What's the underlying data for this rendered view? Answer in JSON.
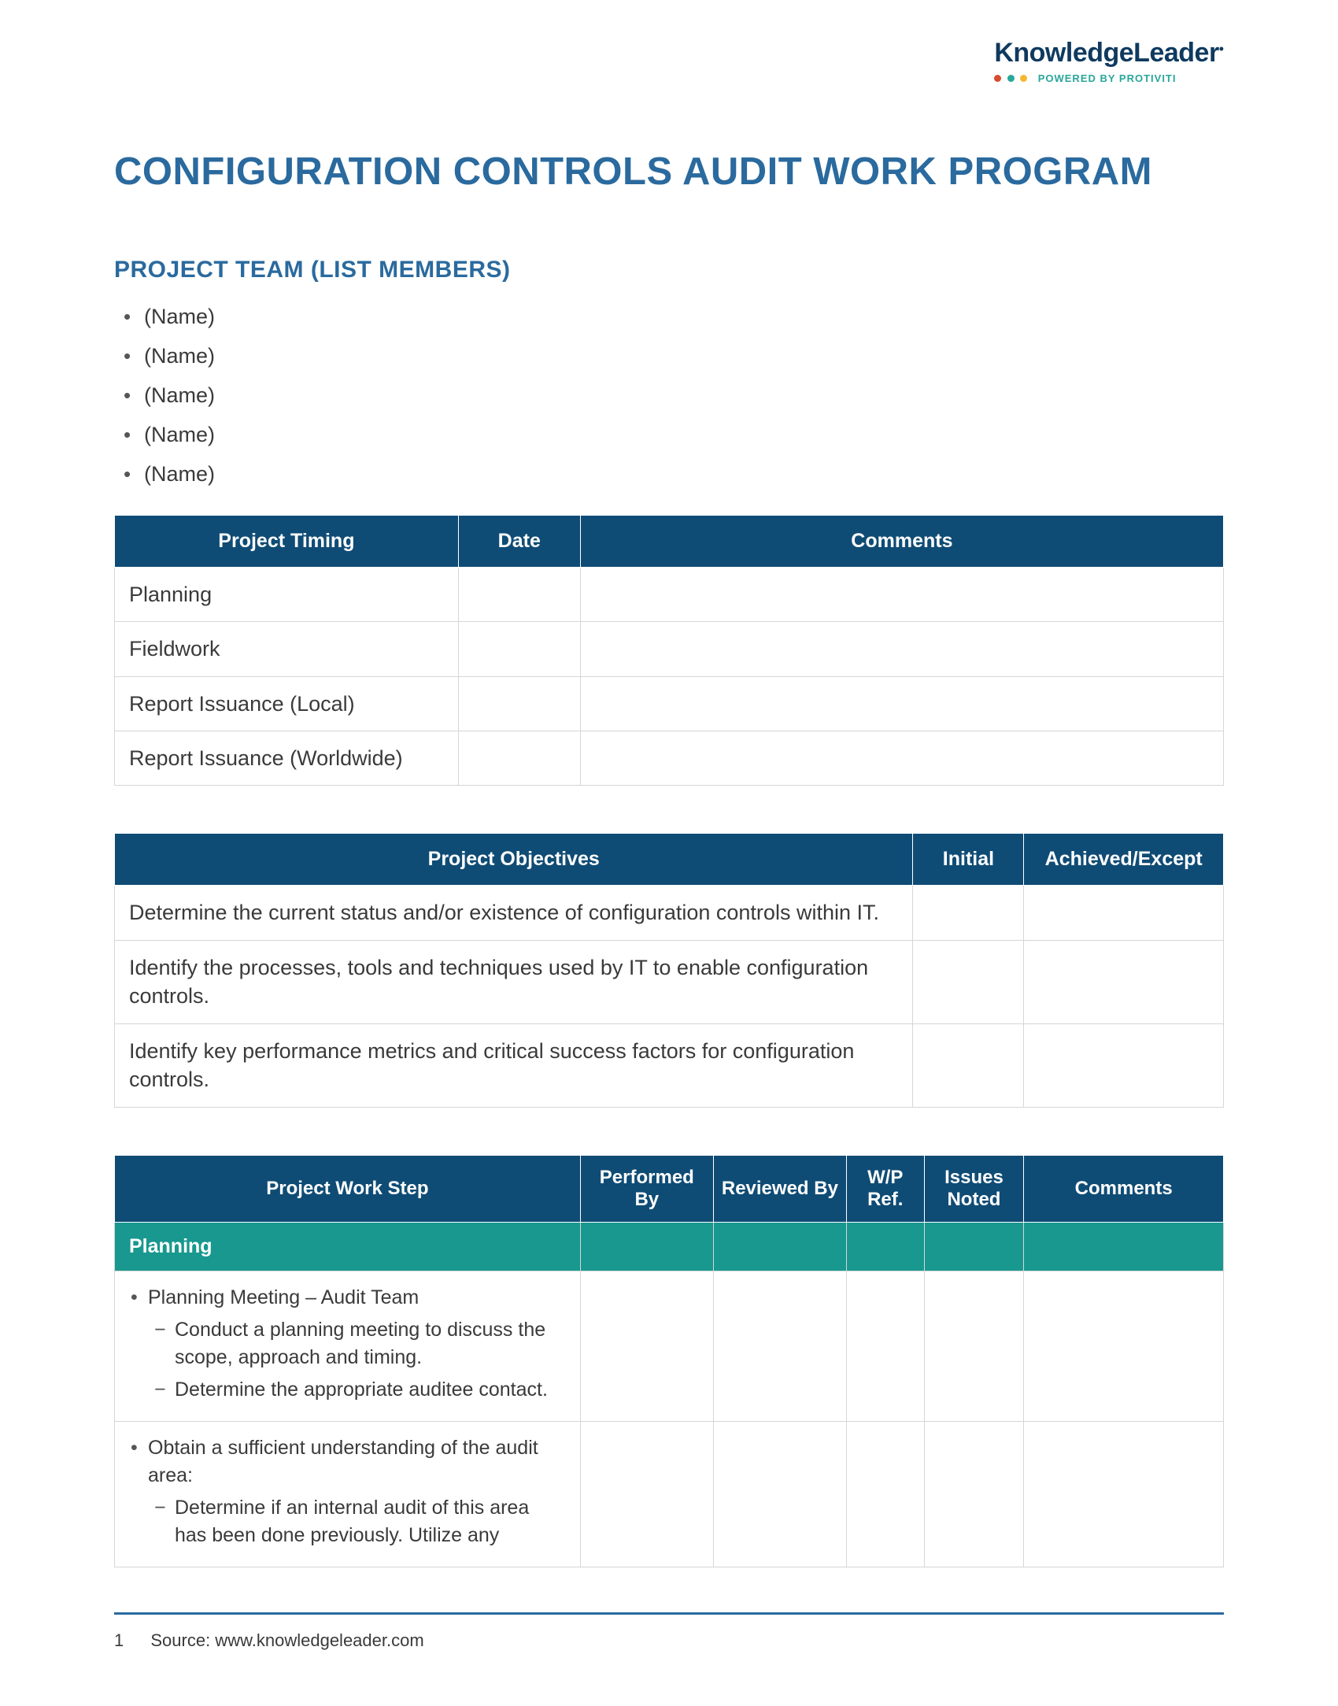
{
  "logo": {
    "brand": "KnowledgeLeader",
    "sub": "POWERED BY PROTIVITI"
  },
  "title": "CONFIGURATION CONTROLS AUDIT WORK PROGRAM",
  "team": {
    "heading": "PROJECT TEAM (LIST MEMBERS)",
    "members": [
      "(Name)",
      "(Name)",
      "(Name)",
      "(Name)",
      "(Name)"
    ]
  },
  "timing_table": {
    "headers": [
      "Project Timing",
      "Date",
      "Comments"
    ],
    "rows": [
      {
        "label": "Planning",
        "date": "",
        "comments": ""
      },
      {
        "label": "Fieldwork",
        "date": "",
        "comments": ""
      },
      {
        "label": "Report Issuance (Local)",
        "date": "",
        "comments": ""
      },
      {
        "label": "Report Issuance (Worldwide)",
        "date": "",
        "comments": ""
      }
    ]
  },
  "objectives_table": {
    "headers": [
      "Project Objectives",
      "Initial",
      "Achieved/Except"
    ],
    "rows": [
      {
        "obj": "Determine the current status and/or existence of configuration controls within IT.",
        "initial": "",
        "ae": ""
      },
      {
        "obj": "Identify the processes, tools and techniques used by IT to enable configuration controls.",
        "initial": "",
        "ae": ""
      },
      {
        "obj": "Identify key performance metrics and critical success factors for configuration controls.",
        "initial": "",
        "ae": ""
      }
    ]
  },
  "worksteps_table": {
    "headers": [
      "Project Work Step",
      "Performed By",
      "Reviewed By",
      "W/P Ref.",
      "Issues Noted",
      "Comments"
    ],
    "section": "Planning",
    "rows": [
      {
        "title": "Planning Meeting – Audit Team",
        "subs": [
          "Conduct a planning meeting to discuss the scope, approach and timing.",
          "Determine the appropriate auditee contact."
        ]
      },
      {
        "title": "Obtain a sufficient understanding of the audit area:",
        "subs": [
          "Determine if an internal audit of this area has been done previously. Utilize any"
        ]
      }
    ]
  },
  "footer": {
    "page": "1",
    "source": "Source: www.knowledgeleader.com"
  }
}
